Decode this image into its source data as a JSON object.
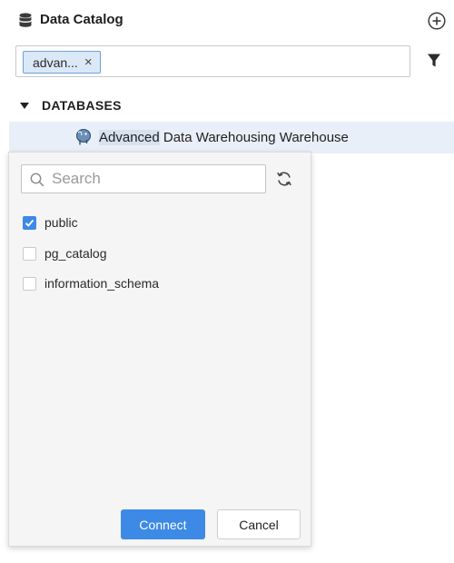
{
  "header": {
    "title": "Data Catalog",
    "icon": "database-icon",
    "add_icon": "add-circle-icon"
  },
  "filter": {
    "chip_label": "advan...",
    "chip_close": "×",
    "filter_icon": "funnel-icon"
  },
  "databases": {
    "section_label": "DATABASES",
    "items": [
      {
        "name_highlight": "Advanced",
        "name_rest": " Data Warehousing Warehouse",
        "icon": "postgresql-icon"
      }
    ]
  },
  "schema_popup": {
    "search_placeholder": "Search",
    "refresh_icon": "refresh-icon",
    "schemas": [
      {
        "label": "public",
        "checked": true
      },
      {
        "label": "pg_catalog",
        "checked": false
      },
      {
        "label": "information_schema",
        "checked": false
      }
    ],
    "connect_label": "Connect",
    "cancel_label": "Cancel"
  },
  "colors": {
    "accent": "#3d8ae6",
    "selected_row": "#e9eff8",
    "chip_bg": "#dbe8f7",
    "chip_border": "#6fa0d8"
  }
}
